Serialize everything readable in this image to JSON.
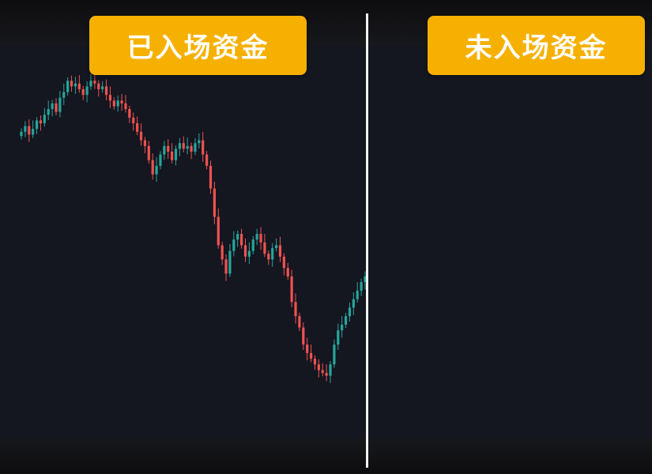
{
  "labels": {
    "left": "已入场资金",
    "right": "未入场资金"
  },
  "colors": {
    "up": "#26a69a",
    "down": "#ef5350",
    "label_bg": "#f6b001",
    "divider": "#f2f2f2"
  },
  "chart_data": {
    "type": "candlestick",
    "grid": false,
    "close": [
      100,
      102,
      99,
      101,
      104,
      103,
      106,
      108,
      110,
      107,
      112,
      114,
      118,
      116,
      117,
      115,
      113,
      116,
      118,
      117,
      115,
      116,
      113,
      111,
      109,
      111,
      110,
      108,
      105,
      103,
      100,
      97,
      95,
      90,
      85,
      88,
      92,
      95,
      93,
      90,
      94,
      96,
      94,
      95,
      93,
      96,
      97,
      92,
      88,
      80,
      70,
      60,
      55,
      50,
      58,
      62,
      64,
      60,
      56,
      58,
      62,
      64,
      61,
      57,
      55,
      59,
      60,
      56,
      52,
      49,
      40,
      35,
      31,
      25,
      22,
      20,
      18,
      16,
      15,
      14,
      18,
      25,
      30,
      32,
      35,
      38,
      41,
      44,
      47,
      49
    ]
  }
}
